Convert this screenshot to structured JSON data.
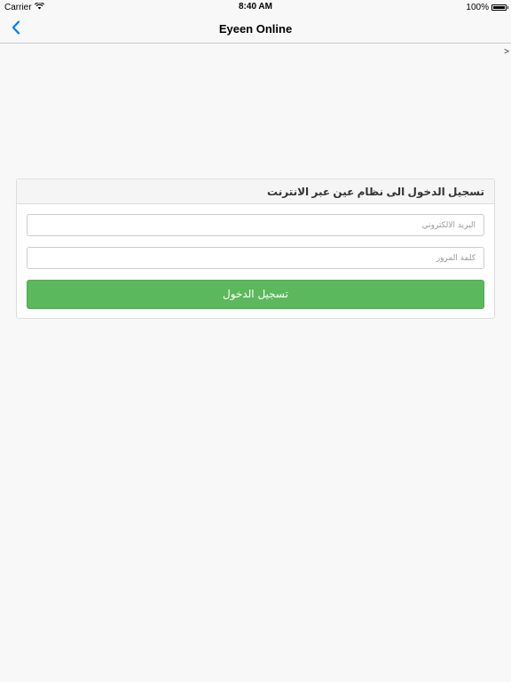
{
  "status_bar": {
    "carrier": "Carrier",
    "time": "8:40 AM",
    "battery_percent": "100%",
    "battery_level": 1.0
  },
  "nav": {
    "title": "Eyeen Online",
    "back_icon": "chevron-left-icon",
    "side_indicator": ">"
  },
  "login": {
    "header": "تسجيل الدخول الى نظام عين عبر الانترنت",
    "email_placeholder": "البريد الالكتروني",
    "email_value": "",
    "password_placeholder": "كلمة المرور",
    "password_value": "",
    "submit_label": "تسجيل الدخول"
  },
  "colors": {
    "accent": "#007aff",
    "button": "#5cb85c",
    "background": "#f8f8f8"
  }
}
